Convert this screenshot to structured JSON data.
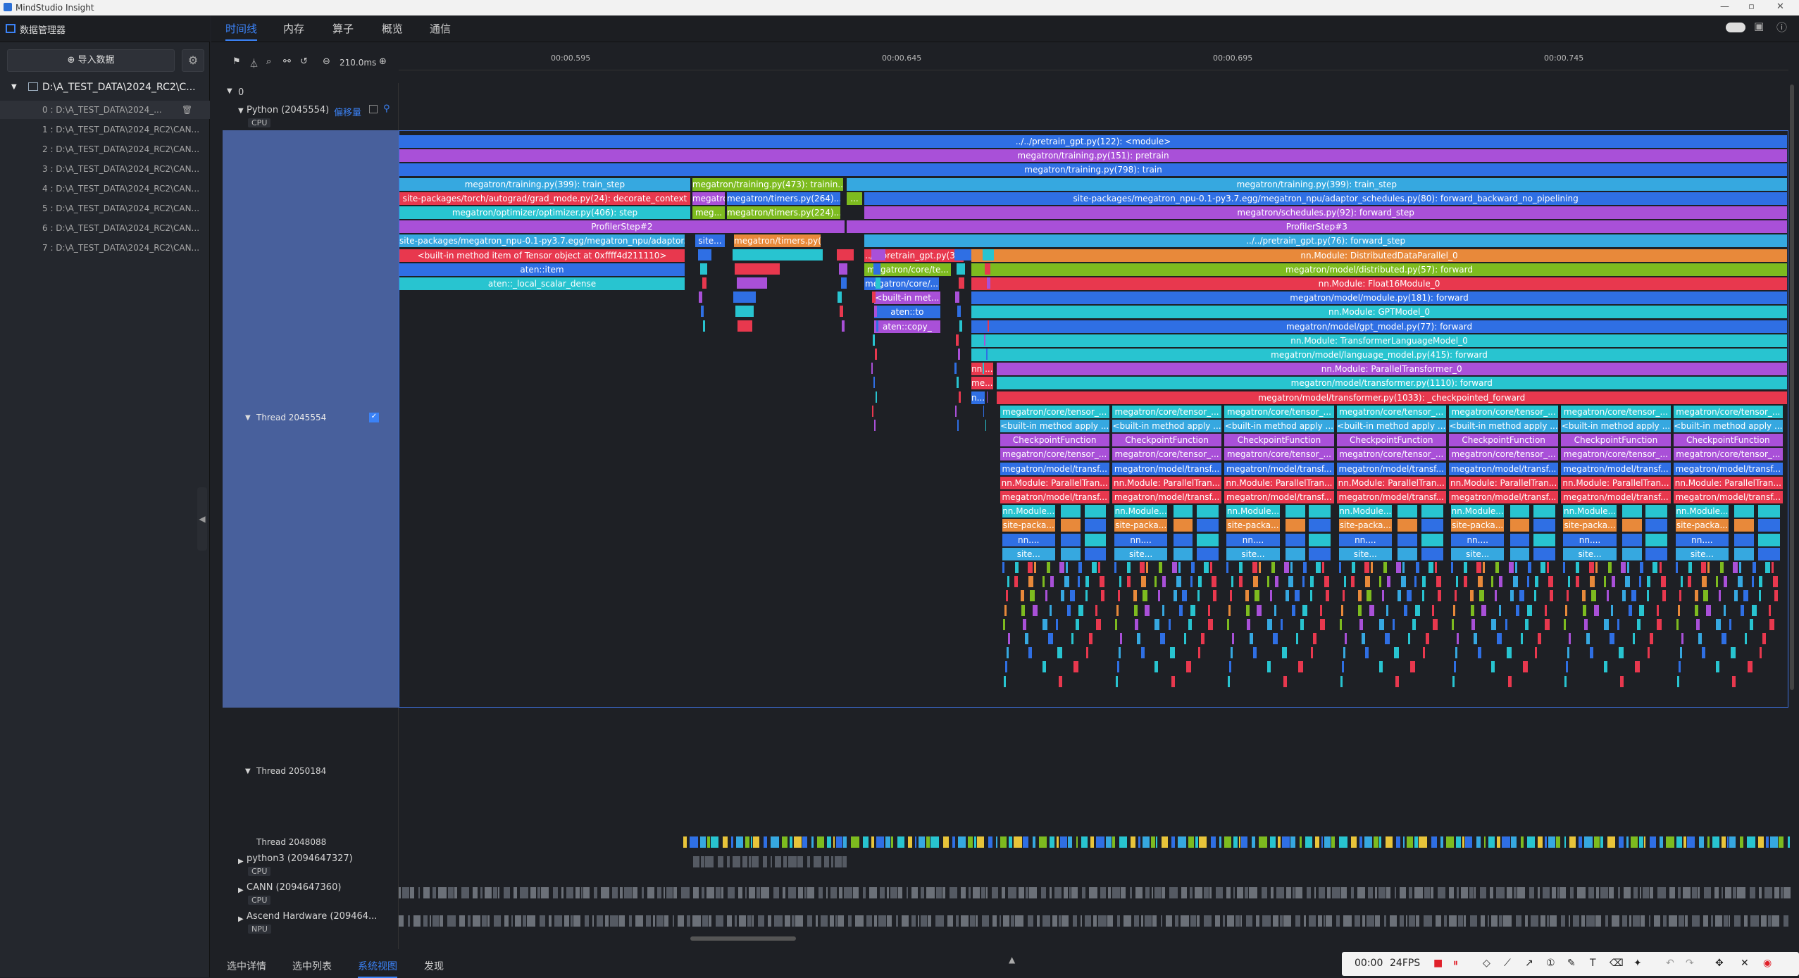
{
  "window": {
    "title": "MindStudio Insight",
    "controls": [
      "—",
      "▫",
      "✕"
    ]
  },
  "sidebar": {
    "header_label": "数据管理器",
    "import_button": "导入数据",
    "root": "D:\\A_TEST_DATA\\2024_RC2\\C...",
    "items": [
      "0 : D:\\A_TEST_DATA\\2024_...",
      "1 : D:\\A_TEST_DATA\\2024_RC2\\CAN...",
      "2 : D:\\A_TEST_DATA\\2024_RC2\\CAN...",
      "3 : D:\\A_TEST_DATA\\2024_RC2\\CAN...",
      "4 : D:\\A_TEST_DATA\\2024_RC2\\CAN...",
      "5 : D:\\A_TEST_DATA\\2024_RC2\\CAN...",
      "6 : D:\\A_TEST_DATA\\2024_RC2\\CAN...",
      "7 : D:\\A_TEST_DATA\\2024_RC2\\CAN..."
    ]
  },
  "tabs": [
    "时间线",
    "内存",
    "算子",
    "概览",
    "通信"
  ],
  "toolbar": {
    "zoom": "210.0ms"
  },
  "ruler": [
    "00:00.595",
    "00:00.645",
    "00:00.695",
    "00:00.745"
  ],
  "tracks": {
    "card": "0",
    "python_process": "Python (2045554)",
    "offset_label": "偏移量",
    "cpu": "CPU",
    "npu": "NPU",
    "thread_a": "Thread 2045554",
    "thread_b": "Thread 2050184",
    "thread_c": "Thread 2048088",
    "python3": "python3 (2094647327)",
    "cann": "CANN (2094647360)",
    "ascend": "Ascend Hardware (209464..."
  },
  "flame": {
    "rows": [
      [
        [
          "../../pretrain_gpt.py(122): <module>",
          "#2f6fe4",
          0,
          100
        ]
      ],
      [
        [
          "megatron/training.py(151): pretrain",
          "#a950d8",
          0,
          100
        ]
      ],
      [
        [
          "megatron/training.py(798): train",
          "#2f6fe4",
          0,
          100
        ]
      ],
      [
        [
          "megatron/training.py(399): train_step",
          "#36a8e0",
          0,
          21
        ],
        [
          "megatron/training.py(473): trainin...",
          "#7dbb1f",
          21.1,
          10.9
        ],
        [
          "megatron/training.py(399): train_step",
          "#36a8e0",
          32.2,
          67.8
        ]
      ],
      [
        [
          "site-packages/torch/autograd/grad_mode.py(24): decorate_context",
          "#e8384e",
          0,
          21
        ],
        [
          "megatron...",
          "#a950d8",
          21.1,
          2.4
        ],
        [
          "megatron/timers.py(264)...",
          "#2f6fe4",
          23.6,
          8.2
        ],
        [
          "...",
          "#7dbb1f",
          32.2,
          1.2
        ],
        [
          "site-packages/megatron_npu-0.1-py3.7.egg/megatron_npu/adaptor_schedules.py(80): forward_backward_no_pipelining",
          "#2f6fe4",
          33.5,
          66.5
        ]
      ],
      [
        [
          "megatron/optimizer/optimizer.py(406): step",
          "#28c4d0",
          0,
          21
        ],
        [
          "meg...",
          "#7dbb1f",
          21.1,
          2.4
        ],
        [
          "megatron/timers.py(224)...",
          "#7dbb1f",
          23.6,
          8.2
        ],
        [
          "megatron/schedules.py(92): forward_step",
          "#a950d8",
          33.5,
          66.5
        ]
      ],
      [
        [
          "ProfilerStep#2",
          "#a950d8",
          0,
          32.1
        ],
        [
          "ProfilerStep#3",
          "#a950d8",
          32.2,
          67.8
        ]
      ],
      [
        [
          "site-packages/megatron_npu-0.1-py3.7.egg/megatron_npu/adaptor...",
          "#36a8e0",
          0,
          20.6
        ],
        [
          "site...",
          "#2f6fe4",
          21.3,
          2.2
        ],
        [
          "megatron/timers.py(206)...",
          "#e8893a",
          24.1,
          6.3
        ],
        [
          "../../pretrain_gpt.py(76): forward_step",
          "#36a8e0",
          33.5,
          66.5
        ]
      ],
      [
        [
          "<built-in method item of Tensor object at 0xffff4d211110>",
          "#e8384e",
          0,
          20.6
        ],
        [
          "../../pretrain_gpt.py(3...",
          "#e8384e",
          33.5,
          7.2
        ],
        [
          "nn.Module: DistributedDataParallel_0",
          "#e8893a",
          41.2,
          58.8
        ]
      ],
      [
        [
          "aten::item",
          "#2f6fe4",
          0,
          20.6
        ],
        [
          "megatron/core/te...",
          "#7dbb1f",
          33.5,
          6.3
        ],
        [
          "megatron/model/distributed.py(57): forward",
          "#7dbb1f",
          41.2,
          58.8
        ]
      ],
      [
        [
          "aten::_local_scalar_dense",
          "#28c4d0",
          0,
          20.6
        ],
        [
          "megatron/core/...",
          "#2f6fe4",
          33.5,
          5.4
        ],
        [
          "nn.Module: Float16Module_0",
          "#e8384e",
          41.2,
          58.8
        ]
      ],
      [
        [
          "<built-in met...",
          "#a950d8",
          34.2,
          4.8
        ],
        [
          "megatron/model/module.py(181): forward",
          "#2f6fe4",
          41.2,
          58.8
        ]
      ],
      [
        [
          "aten::to",
          "#2f6fe4",
          34.2,
          4.8
        ],
        [
          "nn.Module: GPTModel_0",
          "#28c4d0",
          41.2,
          58.8
        ]
      ],
      [
        [
          "aten::copy_",
          "#a950d8",
          34.2,
          4.8
        ],
        [
          "megatron/model/gpt_model.py(77): forward",
          "#2f6fe4",
          41.2,
          58.8
        ]
      ],
      [
        [
          "nn.Module: TransformerLanguageModel_0",
          "#28c4d0",
          41.2,
          58.8
        ]
      ],
      [
        [
          "megatron/model/language_model.py(415): forward",
          "#28c4d0",
          41.2,
          58.8
        ]
      ],
      [
        [
          "nn....",
          "#e8384e",
          41.2,
          1.6
        ],
        [
          "nn.Module: ParallelTransformer_0",
          "#a950d8",
          43.0,
          57.0
        ]
      ],
      [
        [
          "me...",
          "#e8384e",
          41.2,
          1.6
        ],
        [
          "megatron/model/transformer.py(1110): forward",
          "#28c4d0",
          43.0,
          57.0
        ]
      ],
      [
        [
          "n...",
          "#2f6fe4",
          41.2,
          1.0
        ],
        [
          "megatron/model/transformer.py(1033): _checkpointed_forward",
          "#e8384e",
          43.0,
          57.0
        ]
      ]
    ],
    "repeat_rows": [
      [
        "megatron/core/tensor_...",
        "#28c4d0"
      ],
      [
        "<built-in method apply ...",
        "#36a8e0"
      ],
      [
        "CheckpointFunction",
        "#a950d8"
      ],
      [
        "megatron/core/tensor_...",
        "#a950d8"
      ],
      [
        "megatron/model/transf...",
        "#2f6fe4"
      ],
      [
        "nn.Module: ParallelTran...",
        "#e8384e"
      ],
      [
        "megatron/model/transf...",
        "#e8384e"
      ]
    ],
    "frag_rows": [
      [
        "nn.Module...",
        "#28c4d0"
      ],
      [
        "site-packa...",
        "#e8893a"
      ],
      [
        "nn....",
        "#2f6fe4"
      ],
      [
        "site...",
        "#36a8e0"
      ]
    ],
    "blocks": 7
  },
  "bottom_tabs": [
    "选中详情",
    "选中列表",
    "系统视图",
    "发现"
  ],
  "recorder": {
    "time": "00:00",
    "fps": "24FPS"
  }
}
